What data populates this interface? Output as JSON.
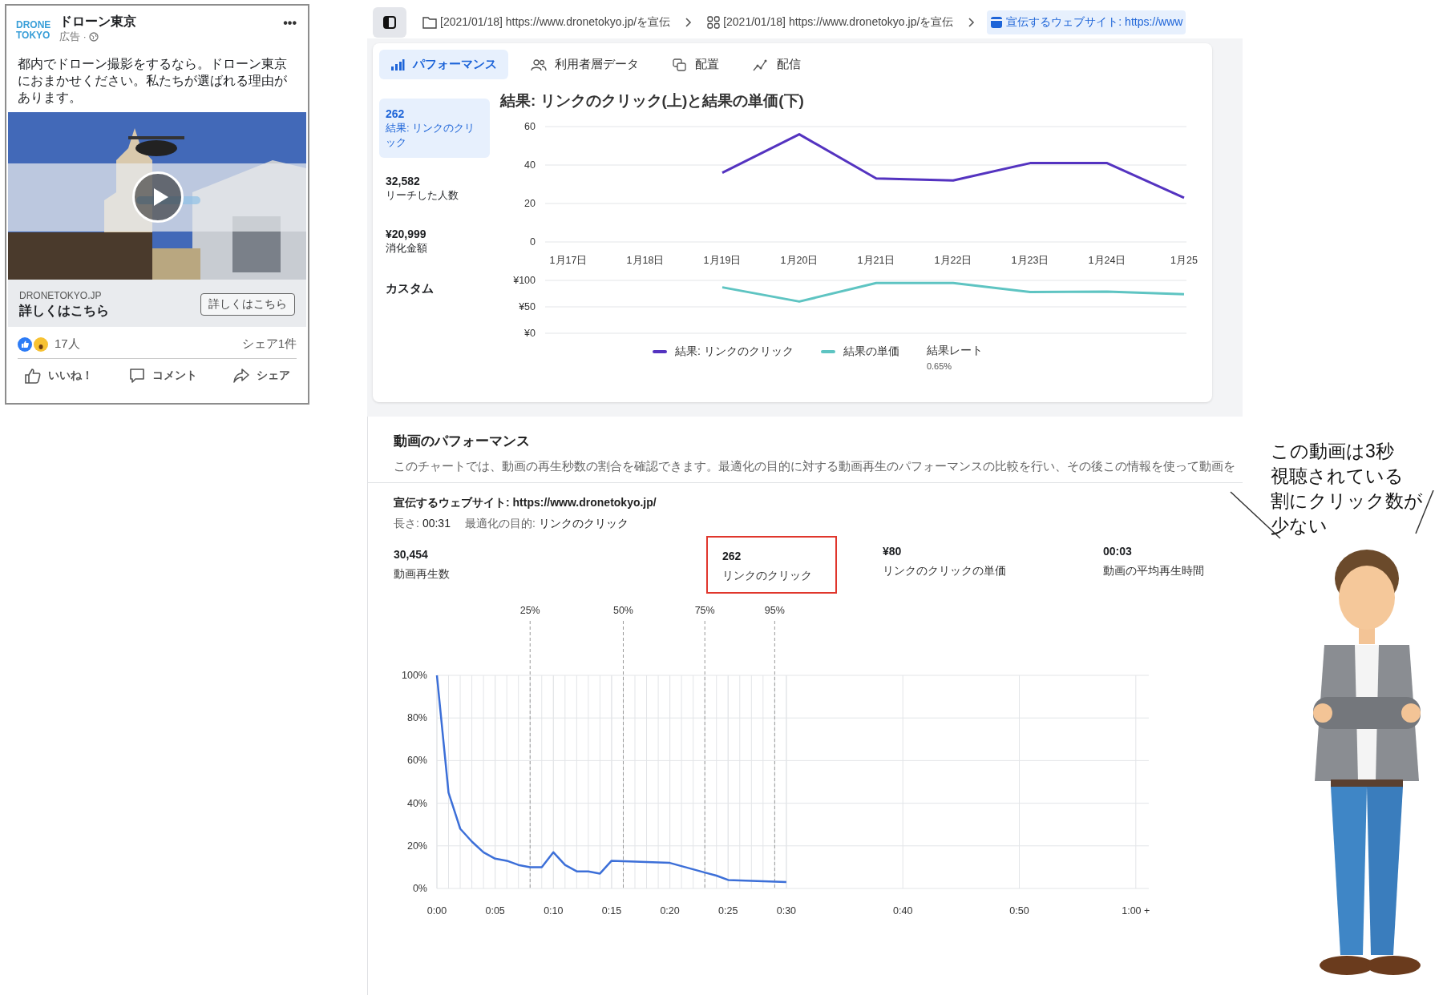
{
  "ad_post": {
    "logo": [
      "DRONE",
      "TOKYO"
    ],
    "page_name": "ドローン東京",
    "sponsored": "広告 ·",
    "menu": "•••",
    "body": "都内でドローン撮影をするなら。ドローン東京におまかせください。私たちが選ばれる理由があります。",
    "media": {
      "kind": "video"
    },
    "link": {
      "domain": "DRONETOKYO.JP",
      "headline": "詳しくはこちら",
      "button": "詳しくはこちら"
    },
    "reactions": {
      "count": "17人",
      "shares": "シェア1件"
    },
    "actions": [
      {
        "kind": "like",
        "label": "いいね！"
      },
      {
        "kind": "comment",
        "label": "コメント"
      },
      {
        "kind": "share",
        "label": "シェア"
      }
    ]
  },
  "breadcrumbs": [
    {
      "kind": "folder",
      "label": "[2021/01/18] https://www.dronetokyo.jp/を宣伝",
      "selected": false
    },
    {
      "kind": "grid",
      "label": "[2021/01/18] https://www.dronetokyo.jp/を宣伝",
      "selected": false
    },
    {
      "kind": "ad",
      "label": "宣伝するウェブサイト: https://www",
      "selected": true
    }
  ],
  "performance": {
    "tabs": [
      {
        "kind": "chart",
        "label": "パフォーマンス",
        "selected": true
      },
      {
        "kind": "people",
        "label": "利用者層データ",
        "selected": false
      },
      {
        "kind": "placement",
        "label": "配置",
        "selected": false
      },
      {
        "kind": "delivery",
        "label": "配信",
        "selected": false
      }
    ],
    "metrics": [
      {
        "value": "262",
        "label": "結果: リンクのクリック",
        "selected": true
      },
      {
        "value": "32,582",
        "label": "リーチした人数",
        "selected": false
      },
      {
        "value": "¥20,999",
        "label": "消化金額",
        "selected": false
      }
    ],
    "custom": "カスタム",
    "title": "結果: リンクのクリック(上)と結果の単価(下)",
    "results_chart": {
      "chart_data": {
        "type": "line",
        "grid": true,
        "categories": [
          "1月17日",
          "1月18日",
          "1月19日",
          "1月20日",
          "1月21日",
          "1月22日",
          "1月23日",
          "1月24日",
          "1月25"
        ],
        "ylim": [
          0,
          60
        ],
        "yticks": [
          0,
          20,
          40,
          60
        ],
        "series": [
          {
            "name": "結果: リンクのクリック",
            "color": "#5433c0",
            "values": [
              null,
              null,
              36,
              56,
              33,
              32,
              41,
              41,
              23
            ]
          }
        ]
      }
    },
    "cost_chart": {
      "chart_data": {
        "type": "line",
        "grid": true,
        "ylim": [
          0,
          100
        ],
        "yticks": [
          {
            "value": 0,
            "label": "¥0"
          },
          {
            "value": 50,
            "label": "¥50"
          },
          {
            "value": 100,
            "label": "¥100"
          }
        ],
        "series": [
          {
            "name": "結果の単価",
            "color": "#5ec4c2",
            "values": [
              null,
              null,
              87,
              60,
              95,
              95,
              78,
              79,
              74
            ]
          }
        ]
      }
    },
    "rate": {
      "label": "結果レート",
      "value": "0.65%"
    }
  },
  "video_performance": {
    "title": "動画のパフォーマンス",
    "description": "このチャートでは、動画の再生秒数の割合を確認できます。最適化の目的に対する動画再生のパフォーマンスの比較を行い、その後この情報を使って動画を",
    "ad_name": "宣伝するウェブサイト: https://www.dronetokyo.jp/",
    "meta": [
      {
        "label": "長さ:",
        "value": "00:31"
      },
      {
        "label": "最適化の目的:",
        "value": "リンクのクリック"
      }
    ],
    "stats": [
      {
        "value": "30,454",
        "label": "動画再生数",
        "highlighted": false
      },
      {
        "value": "262",
        "label": "リンクのクリック",
        "highlighted": true
      },
      {
        "value": "¥80",
        "label": "リンクのクリックの単価",
        "highlighted": false
      },
      {
        "value": "00:03",
        "label": "動画の平均再生時間",
        "highlighted": false
      }
    ],
    "chart_data": {
      "type": "line",
      "grid": true,
      "x": [
        0,
        1,
        2,
        3,
        4,
        5,
        6,
        7,
        8,
        9,
        10,
        11,
        12,
        13,
        14,
        15,
        16,
        17,
        18,
        19,
        20,
        21,
        22,
        23,
        24,
        25,
        26,
        27,
        28,
        29,
        30
      ],
      "xlim": [
        0,
        60
      ],
      "ylim": [
        0,
        100
      ],
      "xticks": [
        {
          "value": 0,
          "label": "0:00"
        },
        {
          "value": 5,
          "label": "0:05"
        },
        {
          "value": 10,
          "label": "0:10"
        },
        {
          "value": 15,
          "label": "0:15"
        },
        {
          "value": 20,
          "label": "0:20"
        },
        {
          "value": 25,
          "label": "0:25"
        },
        {
          "value": 30,
          "label": "0:30"
        },
        {
          "value": 40,
          "label": "0:40"
        },
        {
          "value": 50,
          "label": "0:50"
        },
        {
          "value": 60,
          "label": "1:00 +"
        }
      ],
      "yticks": [
        {
          "value": 0,
          "label": "0%"
        },
        {
          "value": 20,
          "label": "20%"
        },
        {
          "value": 40,
          "label": "40%"
        },
        {
          "value": 60,
          "label": "60%"
        },
        {
          "value": 80,
          "label": "80%"
        },
        {
          "value": 100,
          "label": "100%"
        }
      ],
      "series": [
        {
          "color": "#3c6fd8",
          "values": [
            100,
            45,
            28,
            22,
            17,
            14,
            13,
            11,
            10,
            10,
            17,
            11,
            8,
            8,
            7,
            13,
            12.8,
            12.6,
            12.4,
            12.2,
            12,
            10.5,
            9,
            7.5,
            6,
            4,
            3.8,
            3.6,
            3.4,
            3.2,
            3
          ]
        }
      ],
      "annotations": [
        {
          "x": 8,
          "text": "25%"
        },
        {
          "x": 16,
          "text": "50%"
        },
        {
          "x": 23,
          "text": "75%"
        },
        {
          "x": 29,
          "text": "95%"
        }
      ]
    }
  },
  "commentary": {
    "speech": [
      "この動画は3秒",
      "視聴されている",
      "割にクリック数が",
      "少ない"
    ],
    "figure": {
      "kind": "person"
    }
  }
}
